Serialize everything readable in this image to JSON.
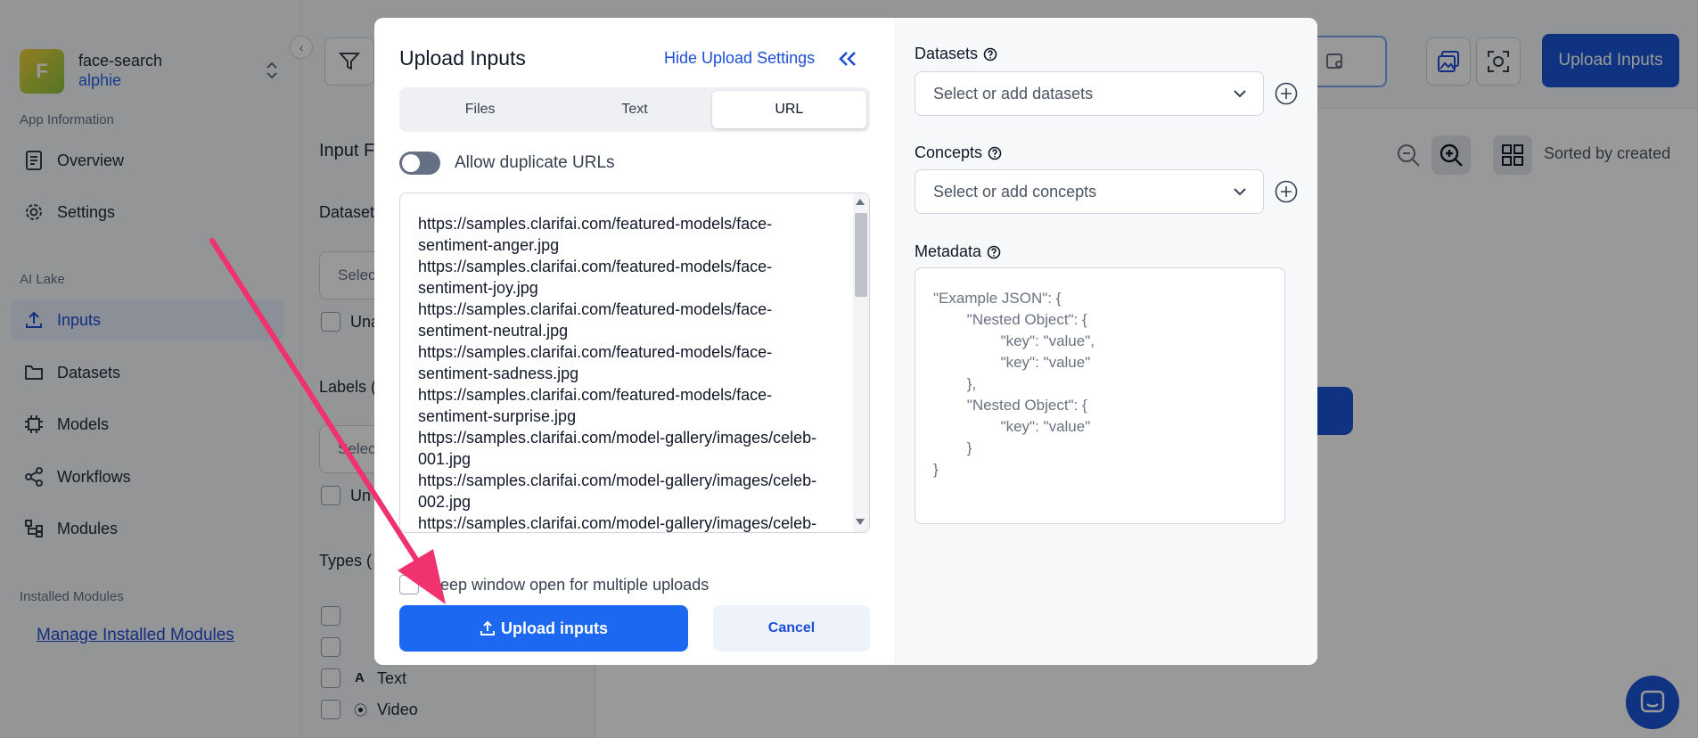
{
  "sidebar": {
    "app_initial": "F",
    "app_name": "face-search",
    "app_user": "alphie",
    "section_app_info": "App Information",
    "overview": "Overview",
    "settings": "Settings",
    "section_ai_lake": "AI Lake",
    "inputs": "Inputs",
    "datasets": "Datasets",
    "models": "Models",
    "workflows": "Workflows",
    "modules": "Modules",
    "section_installed": "Installed Modules",
    "manage_link": "Manage Installed Modules"
  },
  "background": {
    "input_filter_title": "Input F",
    "datasets_label": "Dataset",
    "select_placeholder_1": "Selec",
    "select_placeholder_2": "Selec",
    "una_1": "Una",
    "una_2": "Un",
    "labels_label": "Labels (",
    "types_label": "Types (",
    "type_text": "Text",
    "type_video": "Video",
    "upload_inputs_top": "Upload Inputs",
    "sorted_by": "Sorted by created"
  },
  "modal": {
    "title": "Upload Inputs",
    "hide_settings": "Hide Upload Settings",
    "tabs": [
      {
        "label": "Files",
        "active": false
      },
      {
        "label": "Text",
        "active": false
      },
      {
        "label": "URL",
        "active": true
      }
    ],
    "allow_duplicates_label": "Allow duplicate URLs",
    "allow_duplicates_on": false,
    "urls_text": "https://samples.clarifai.com/featured-models/face-sentiment-anger.jpg\nhttps://samples.clarifai.com/featured-models/face-sentiment-joy.jpg\nhttps://samples.clarifai.com/featured-models/face-sentiment-neutral.jpg\nhttps://samples.clarifai.com/featured-models/face-sentiment-sadness.jpg\nhttps://samples.clarifai.com/featured-models/face-sentiment-surprise.jpg\nhttps://samples.clarifai.com/model-gallery/images/celeb-001.jpg\nhttps://samples.clarifai.com/model-gallery/images/celeb-002.jpg\nhttps://samples.clarifai.com/model-gallery/images/celeb-",
    "keep_open_label": "Keep window open for multiple uploads",
    "upload_button": "Upload inputs",
    "cancel_button": "Cancel"
  },
  "settings_panel": {
    "datasets_label": "Datasets",
    "datasets_placeholder": "Select or add datasets",
    "concepts_label": "Concepts",
    "concepts_placeholder": "Select or add concepts",
    "metadata_label": "Metadata",
    "metadata_placeholder": "\"Example JSON\": {\n        \"Nested Object\": {\n                \"key\": \"value\",\n                \"key\": \"value\"\n        },\n        \"Nested Object\": {\n                \"key\": \"value\"\n        }\n}"
  },
  "colors": {
    "primary": "#1d68f0",
    "link": "#1d4ed8",
    "arrow": "#f0326e"
  }
}
